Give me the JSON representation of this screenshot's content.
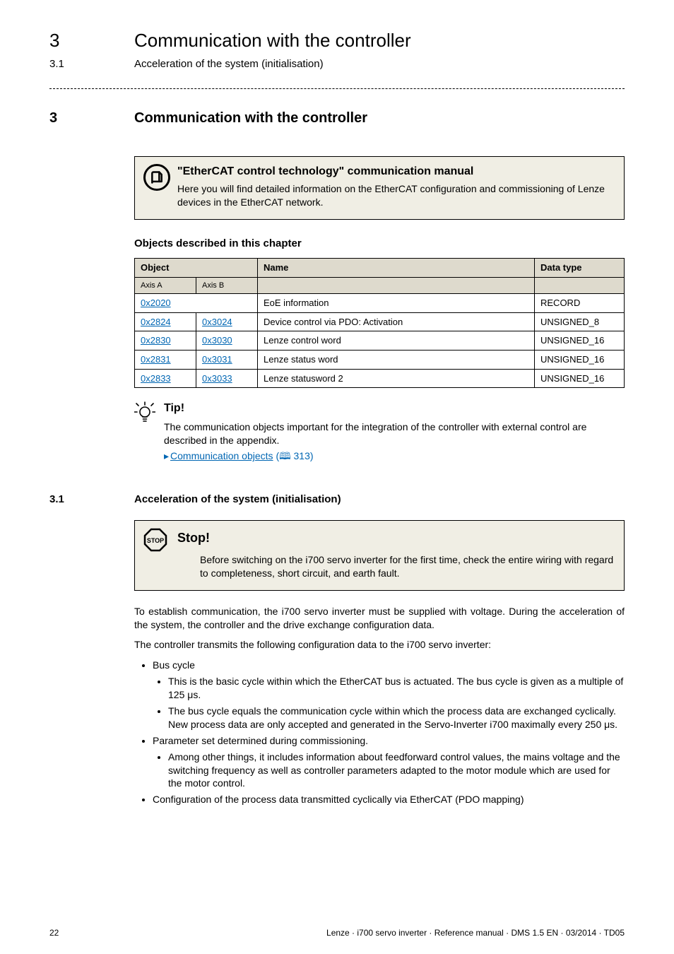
{
  "header": {
    "chapter_num": "3",
    "chapter_title": "Communication with the controller",
    "sub_num": "3.1",
    "sub_title": "Acceleration of the system (initialisation)"
  },
  "section_heading": {
    "num": "3",
    "title": "Communication with the controller"
  },
  "info_box": {
    "title": "\"EtherCAT control technology\" communication manual",
    "text": "Here you will find detailed information on the EtherCAT configuration and commissioning of Lenze devices in the EtherCAT network."
  },
  "objects_heading": "Objects described in this chapter",
  "table": {
    "headers": {
      "object": "Object",
      "name": "Name",
      "data_type": "Data type"
    },
    "axis": {
      "a": "Axis A",
      "b": "Axis B"
    },
    "rows": [
      {
        "a": "0x2020",
        "b": "",
        "name": "EoE information",
        "type": "RECORD",
        "span_ab": true
      },
      {
        "a": "0x2824",
        "b": "0x3024",
        "name": "Device control via PDO: Activation",
        "type": "UNSIGNED_8"
      },
      {
        "a": "0x2830",
        "b": "0x3030",
        "name": "Lenze control word",
        "type": "UNSIGNED_16"
      },
      {
        "a": "0x2831",
        "b": "0x3031",
        "name": "Lenze status word",
        "type": "UNSIGNED_16"
      },
      {
        "a": "0x2833",
        "b": "0x3033",
        "name": "Lenze statusword 2",
        "type": "UNSIGNED_16"
      }
    ]
  },
  "tip": {
    "label": "Tip!",
    "text": "The communication objects important for the integration of the controller with external control are described in the appendix.",
    "link_text": "Communication objects",
    "page_ref": "(🕮 313)"
  },
  "subsection": {
    "num": "3.1",
    "title": "Acceleration of the system (initialisation)"
  },
  "stop": {
    "label": "Stop!",
    "text": "Before switching on the i700 servo inverter for the first time, check the entire wiring with regard to completeness, short circuit, and earth fault."
  },
  "paragraphs": {
    "p1": "To establish communication, the i700 servo inverter must be supplied with voltage. During the acceleration of the system, the controller and the drive exchange configuration data.",
    "p2": "The controller transmits the following configuration data to the i700 servo inverter:"
  },
  "bullets": {
    "b1": "Bus cycle",
    "b1a": "This is the basic cycle within which the EtherCAT bus is actuated. The bus cycle is given as a multiple of 125 μs.",
    "b1b": "The bus cycle equals the communication cycle within which the process data are exchanged cyclically. New process data are only accepted and generated in the Servo-Inverter i700 maximally every 250 μs.",
    "b2": "Parameter set determined during commissioning.",
    "b2a": "Among other things, it includes information about feedforward control values, the mains voltage and the switching frequency as well as controller parameters adapted to the motor module which are used for the motor control.",
    "b3": "Configuration of the process data transmitted cyclically via EtherCAT (PDO mapping)"
  },
  "footer": {
    "page": "22",
    "doc": "Lenze · i700 servo inverter · Reference manual · DMS 1.5 EN · 03/2014 · TD05"
  }
}
